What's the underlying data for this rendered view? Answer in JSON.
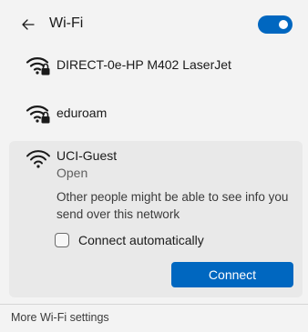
{
  "header": {
    "back_icon": "arrow-left-icon",
    "title": "Wi-Fi",
    "wifi_toggle_on": true
  },
  "networks": [
    {
      "name": "DIRECT-0e-HP M402 LaserJet",
      "icon": "wifi-secured-icon"
    },
    {
      "name": "eduroam",
      "icon": "wifi-secured-icon"
    }
  ],
  "selected_network": {
    "ssid": "UCI-Guest",
    "status": "Open",
    "icon": "wifi-icon",
    "warning": "Other people might be able to see info you send over this network",
    "connect_automatically_label": "Connect automatically",
    "connect_automatically_checked": false,
    "connect_label": "Connect"
  },
  "footer": {
    "more_settings_label": "More Wi-Fi settings"
  },
  "colors": {
    "accent": "#0067c0",
    "background": "#f3f3f3",
    "card": "#e9e9e9"
  }
}
